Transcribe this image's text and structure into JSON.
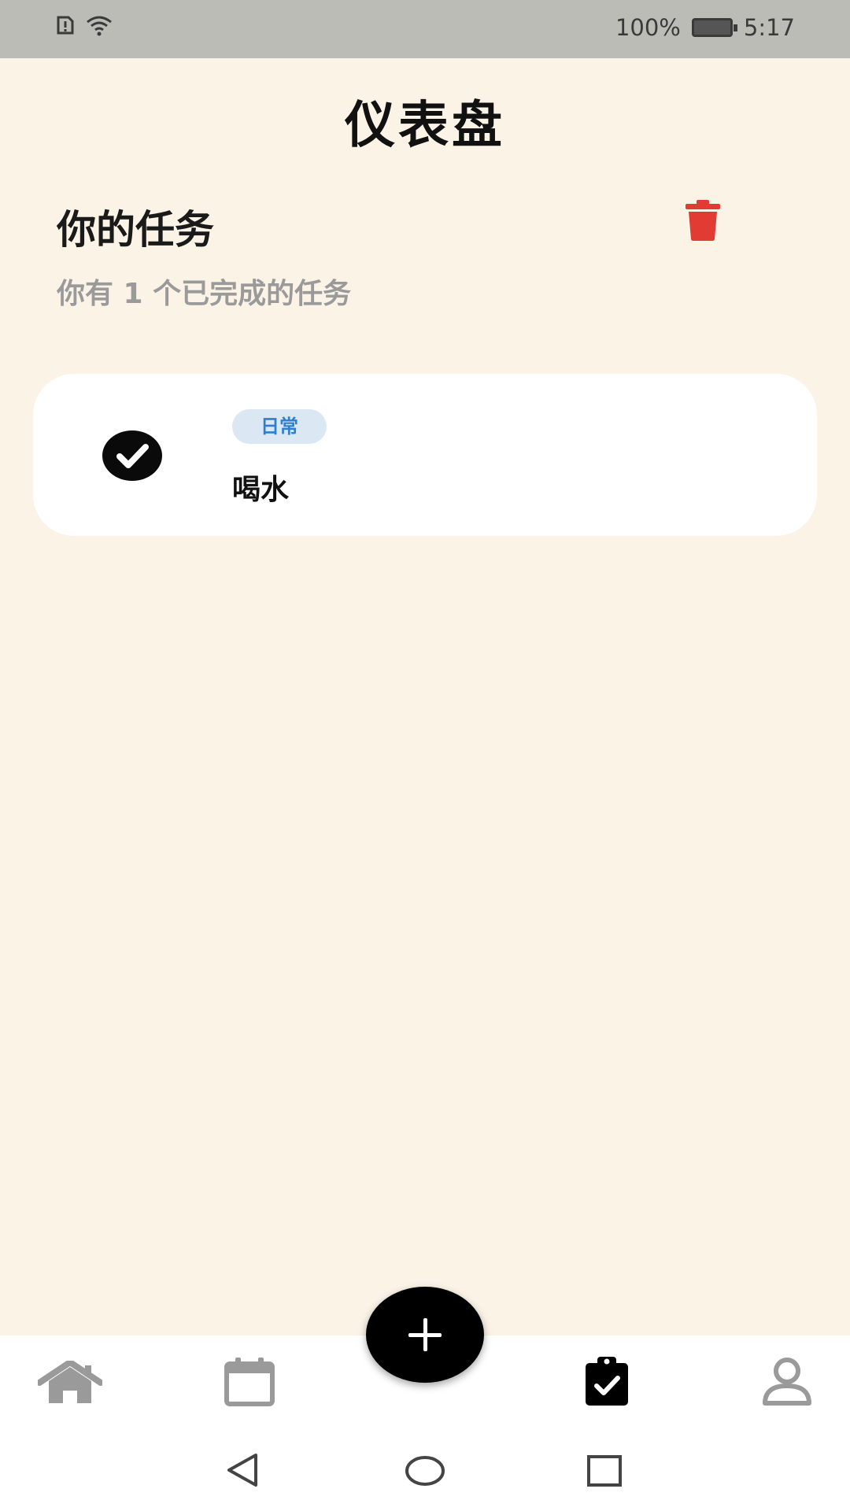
{
  "status_bar": {
    "battery": "100%",
    "time": "5:17"
  },
  "page": {
    "title": "仪表盘"
  },
  "tasks_section": {
    "title": "你的任务",
    "subtitle": "你有 1 个已完成的任务",
    "items": [
      {
        "tag": "日常",
        "name": "喝水",
        "completed": true
      }
    ]
  },
  "colors": {
    "background": "#faf3e6",
    "trash": "#e23b34",
    "tag_bg": "#dbe8f3",
    "tag_text": "#2d7fd2",
    "nav_active": "#000000",
    "nav_inactive": "#9a9a9a"
  },
  "bottom_nav": {
    "items": [
      {
        "icon": "home-icon",
        "active": false
      },
      {
        "icon": "calendar-icon",
        "active": false
      },
      {
        "icon": "add-icon",
        "active": false
      },
      {
        "icon": "tasks-clipboard-icon",
        "active": true
      },
      {
        "icon": "profile-icon",
        "active": false
      }
    ]
  },
  "system_nav": {
    "icons": [
      "back-icon",
      "home-circle-icon",
      "recents-icon"
    ]
  }
}
